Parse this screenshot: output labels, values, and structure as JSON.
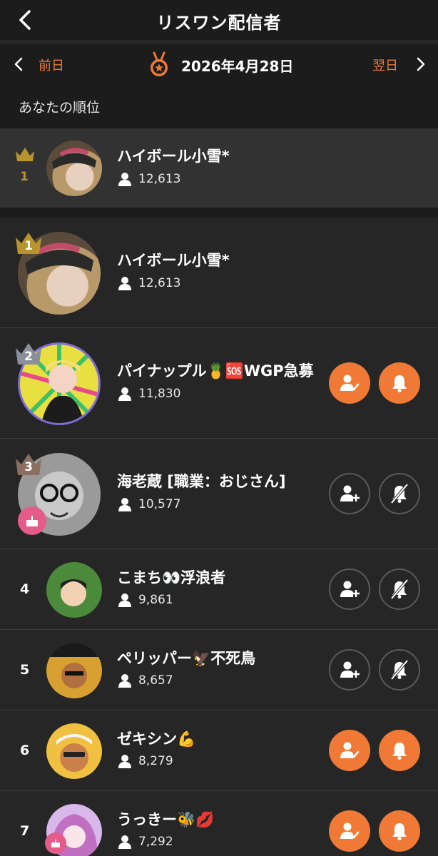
{
  "header": {
    "title": "リスワン配信者"
  },
  "date_nav": {
    "prev_label": "前日",
    "date": "2026年4月28日",
    "next_label": "翌日"
  },
  "my_rank": {
    "section_label": "あなたの順位",
    "rank": "1",
    "name": "ハイボール小雪*",
    "count": "12,613"
  },
  "colors": {
    "accent": "#f07a35",
    "gold": "#b8942f",
    "silver": "#8a8f99",
    "bronze": "#8a6e60"
  },
  "ranking": [
    {
      "rank": "1",
      "name": "ハイボール小雪*",
      "count": "12,613",
      "crown": "gold",
      "buttons": []
    },
    {
      "rank": "2",
      "name": "パイナップル🍍🆘WGP急募",
      "count": "11,830",
      "crown": "silver",
      "buttons": [
        "following",
        "notify-on"
      ]
    },
    {
      "rank": "3",
      "name": "海老蔵 [職業：おじさん]",
      "count": "10,577",
      "crown": "bronze",
      "birthday": true,
      "buttons": [
        "follow",
        "notify-off"
      ]
    },
    {
      "rank": "4",
      "name": "こまち👀浮浪者",
      "count": "9,861",
      "buttons": [
        "follow",
        "notify-off"
      ]
    },
    {
      "rank": "5",
      "name": "ペリッパー🦅不死鳥",
      "count": "8,657",
      "buttons": [
        "follow",
        "notify-off"
      ]
    },
    {
      "rank": "6",
      "name": "ゼキシン💪",
      "count": "8,279",
      "buttons": [
        "following",
        "notify-on"
      ]
    },
    {
      "rank": "7",
      "name": "うっきー🐝💋",
      "count": "7,292",
      "birthday": true,
      "buttons": [
        "following",
        "notify-on"
      ]
    }
  ]
}
